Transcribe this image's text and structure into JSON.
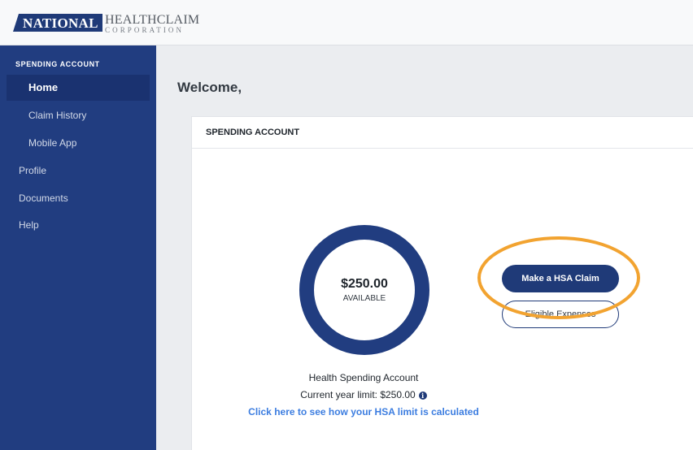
{
  "header": {
    "logo": {
      "badge_text": "NATIONAL",
      "top_text": "HEALTHCLAIM",
      "bottom_text": "CORPORATION"
    }
  },
  "sidebar": {
    "section_title": "SPENDING ACCOUNT",
    "items": [
      {
        "label": "Home",
        "active": true
      },
      {
        "label": "Claim History"
      },
      {
        "label": "Mobile App"
      },
      {
        "label": "Profile"
      },
      {
        "label": "Documents"
      },
      {
        "label": "Help"
      }
    ]
  },
  "main": {
    "welcome": "Welcome,",
    "card": {
      "title": "SPENDING ACCOUNT",
      "ring": {
        "amount": "$250.00",
        "label": "AVAILABLE",
        "available_fraction": 1.0
      },
      "account_name": "Health Spending Account",
      "limit_text": "Current year limit: $250.00",
      "info_glyph": "i",
      "link_text": "Click here to see how your HSA limit is calculated",
      "claim_button": "Make a HSA Claim",
      "eligible_button": "Eligible Expenses"
    }
  },
  "colors": {
    "brand_navy": "#213d80",
    "link_blue": "#3c7de0",
    "highlight_orange": "#f2a330"
  },
  "icons": {
    "info": "info-circle-icon"
  }
}
